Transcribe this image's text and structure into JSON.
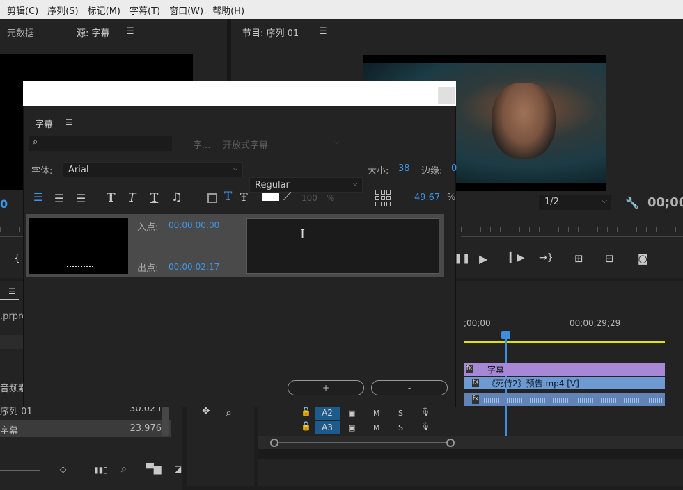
{
  "menu": [
    "剪辑(C)",
    "序列(S)",
    "标记(M)",
    "字幕(T)",
    "窗口(W)",
    "帮助(H)"
  ],
  "left_panel": {
    "tab_metadata": "元数据",
    "tab_source": "源: 字幕",
    "timecode": "0",
    "project_file_fragment": ".prpro",
    "rows": [
      {
        "name": "音频素",
        "rate": ""
      },
      {
        "name": "序列 01",
        "rate": "30.02 f"
      },
      {
        "name": "字幕",
        "rate": "23.976"
      }
    ]
  },
  "program": {
    "title": "节目: 序列 01",
    "resolution": "1/2",
    "timecode": "00;00"
  },
  "timeline": {
    "tc_start": ";00;00",
    "tc_mid": "00;00;29;29",
    "clips": {
      "caption": "字幕",
      "video": "《死侍2》预告.mp4 [V]"
    },
    "tracks": [
      {
        "name": "A2",
        "m": "M",
        "s": "S"
      },
      {
        "name": "A3",
        "m": "M",
        "s": "S"
      }
    ]
  },
  "dialog": {
    "panel_title": "字幕",
    "search_placeholder": "",
    "stream_label": "字...",
    "stream_value": "开放式字幕",
    "font_label": "字体:",
    "font_value": "Arial",
    "style_value": "Regular",
    "size_label": "大小:",
    "size_value": "38",
    "edge_label": "边缘:",
    "edge_value": "0",
    "opacity_value": "100",
    "opacity_unit": "%",
    "position_value": "49.67",
    "position_unit": "%",
    "in_label": "入点:",
    "in_value": "00:00:00:00",
    "out_label": "出点:",
    "out_value": "00:00:02:17",
    "add_button": "+",
    "remove_button": "-"
  },
  "colors": {
    "accent": "#3d96e8",
    "caption_clip": "#a688d6",
    "video_clip": "#6d9ad2",
    "audio_clip": "#6283b5",
    "work_area": "#e6e000",
    "track_label": "#1d5b8c"
  }
}
